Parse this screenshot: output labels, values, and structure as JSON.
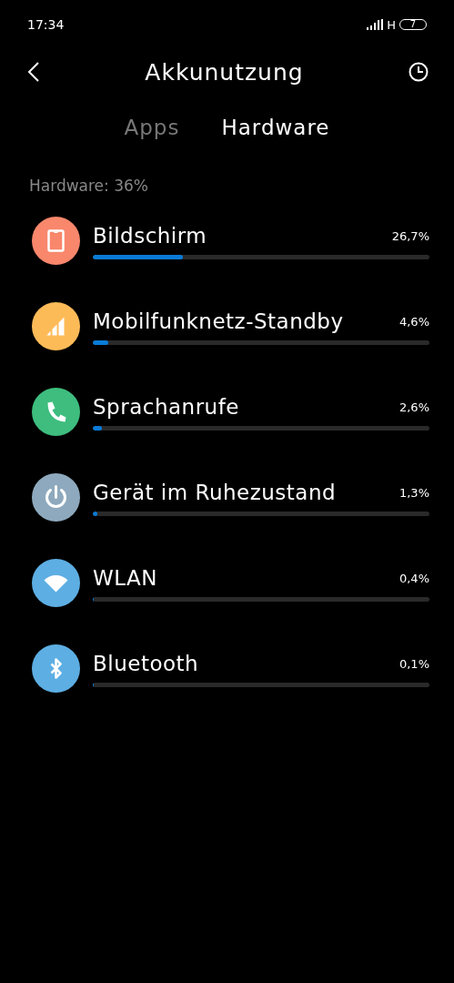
{
  "status_bar": {
    "time": "17:34",
    "network": "H",
    "battery": "7"
  },
  "header": {
    "title": "Akkunutzung"
  },
  "tabs": [
    {
      "label": "Apps",
      "selected": false
    },
    {
      "label": "Hardware",
      "selected": true
    }
  ],
  "section_label": "Hardware: 36%",
  "items": [
    {
      "name": "Bildschirm",
      "percent": "26,7%",
      "level": 0.267,
      "kind": "screen",
      "color": "#f8876c"
    },
    {
      "name": "Mobilfunknetz-Standby",
      "percent": "4,6%",
      "level": 0.046,
      "kind": "signal",
      "color": "#fdbb58"
    },
    {
      "name": "Sprachanrufe",
      "percent": "2,6%",
      "level": 0.026,
      "kind": "phone",
      "color": "#3ebd7e"
    },
    {
      "name": "Gerät im Ruhezustand",
      "percent": "1,3%",
      "level": 0.013,
      "kind": "power",
      "color": "#8ea9bd"
    },
    {
      "name": "WLAN",
      "percent": "0,4%",
      "level": 0.004,
      "kind": "wifi",
      "color": "#5daee3"
    },
    {
      "name": "Bluetooth",
      "percent": "0,1%",
      "level": 0.001,
      "kind": "bluetooth",
      "color": "#5daee3"
    }
  ]
}
